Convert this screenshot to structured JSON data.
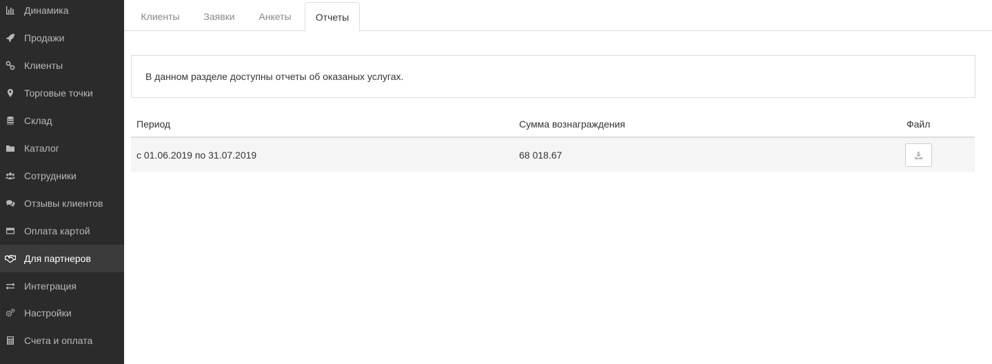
{
  "sidebar": {
    "items": [
      {
        "label": "Динамика",
        "icon": "bar-chart-icon"
      },
      {
        "label": "Продажи",
        "icon": "rocket-icon"
      },
      {
        "label": "Клиенты",
        "icon": "link-icon"
      },
      {
        "label": "Торговые точки",
        "icon": "map-marker-icon"
      },
      {
        "label": "Склад",
        "icon": "database-icon"
      },
      {
        "label": "Каталог",
        "icon": "folder-icon"
      },
      {
        "label": "Сотрудники",
        "icon": "users-icon"
      },
      {
        "label": "Отзывы клиентов",
        "icon": "comments-icon"
      },
      {
        "label": "Оплата картой",
        "icon": "credit-card-icon"
      },
      {
        "label": "Для партнеров",
        "icon": "handshake-icon",
        "active": true
      },
      {
        "label": "Интеграция",
        "icon": "exchange-icon"
      },
      {
        "label": "Настройки",
        "icon": "gears-icon"
      },
      {
        "label": "Счета и оплата",
        "icon": "calculator-icon"
      }
    ]
  },
  "tabs": [
    {
      "label": "Клиенты"
    },
    {
      "label": "Заявки"
    },
    {
      "label": "Анкеты"
    },
    {
      "label": "Отчеты",
      "active": true
    }
  ],
  "info": {
    "text": "В данном разделе доступны отчеты об оказаных услугах."
  },
  "table": {
    "headers": {
      "period": "Период",
      "amount": "Сумма вознаграждения",
      "file": "Файл"
    },
    "rows": [
      {
        "period": "с 01.06.2019 по 31.07.2019",
        "amount": "68 018.67",
        "file_icon": "download-icon"
      }
    ]
  },
  "colors": {
    "sidebar_bg": "#2b2b2b",
    "sidebar_active_bg": "#3b3b3b",
    "row_bg": "#f5f5f5",
    "border": "#dddddd"
  }
}
